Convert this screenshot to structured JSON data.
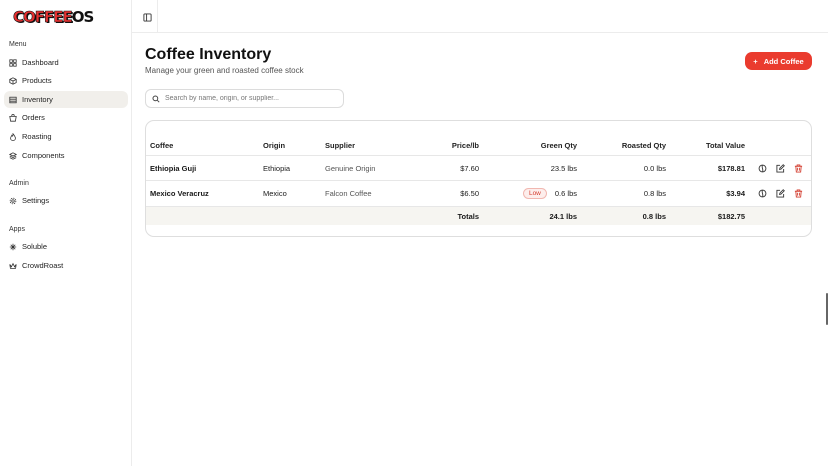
{
  "brand": {
    "logo_main": "COFFEE",
    "logo_suffix": "OS",
    "accent": "#ea3b2e"
  },
  "sidebar": {
    "sections": [
      {
        "label": "Menu",
        "items": [
          {
            "label": "Dashboard",
            "icon": "dashboard-icon",
            "active": false
          },
          {
            "label": "Products",
            "icon": "box-icon",
            "active": false
          },
          {
            "label": "Inventory",
            "icon": "inventory-icon",
            "active": true
          },
          {
            "label": "Orders",
            "icon": "cart-icon",
            "active": false
          },
          {
            "label": "Roasting",
            "icon": "flame-icon",
            "active": false
          },
          {
            "label": "Components",
            "icon": "layers-icon",
            "active": false
          }
        ]
      },
      {
        "label": "Admin",
        "items": [
          {
            "label": "Settings",
            "icon": "gear-icon",
            "active": false
          }
        ]
      },
      {
        "label": "Apps",
        "items": [
          {
            "label": "Soluble",
            "icon": "sparkle-icon",
            "active": false
          },
          {
            "label": "CrowdRoast",
            "icon": "crown-icon",
            "active": false
          }
        ]
      }
    ]
  },
  "page": {
    "title": "Coffee Inventory",
    "subtitle": "Manage your green and roasted coffee stock",
    "add_button": "Add Coffee",
    "search_placeholder": "Search by name, origin, or supplier..."
  },
  "table": {
    "headers": {
      "coffee": "Coffee",
      "origin": "Origin",
      "supplier": "Supplier",
      "price": "Price/lb",
      "green": "Green Qty",
      "roasted": "Roasted Qty",
      "total": "Total Value"
    },
    "rows": [
      {
        "coffee": "Ethiopia Guji",
        "origin": "Ethiopia",
        "supplier": "Genuine Origin",
        "price": "$7.60",
        "green": "23.5 lbs",
        "roasted": "0.0 lbs",
        "total": "$178.81",
        "low": false
      },
      {
        "coffee": "Mexico Veracruz",
        "origin": "Mexico",
        "supplier": "Falcon Coffee",
        "price": "$6.50",
        "green": "0.6 lbs",
        "roasted": "0.8 lbs",
        "total": "$3.94",
        "low": true,
        "low_label": "Low"
      }
    ],
    "totals": {
      "label": "Totals",
      "green": "24.1 lbs",
      "roasted": "0.8 lbs",
      "total": "$182.75"
    }
  }
}
